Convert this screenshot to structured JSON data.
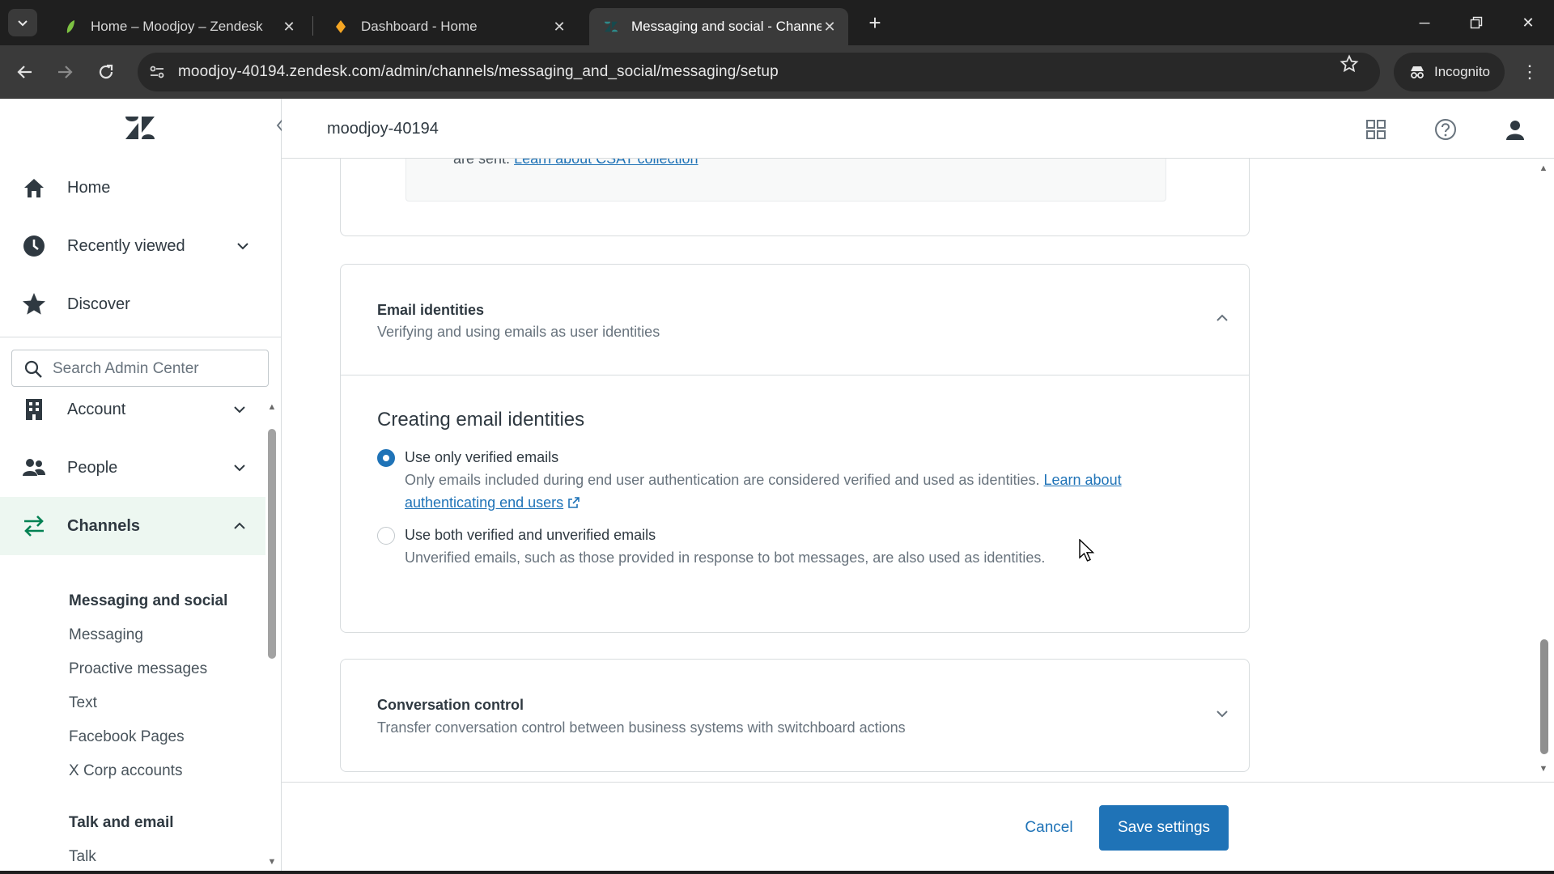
{
  "browser": {
    "tabs": [
      {
        "title": "Home – Moodjoy – Zendesk",
        "active": false,
        "favicon": "zendesk-leaf-icon"
      },
      {
        "title": "Dashboard - Home",
        "active": false,
        "favicon": "dashboard-icon"
      },
      {
        "title": "Messaging and social - Channe",
        "active": true,
        "favicon": "zendesk-icon"
      }
    ],
    "url": "moodjoy-40194.zendesk.com/admin/channels/messaging_and_social/messaging/setup",
    "incognito_label": "Incognito"
  },
  "header": {
    "account_name": "moodjoy-40194"
  },
  "sidebar": {
    "top_items": [
      {
        "label": "Home",
        "icon": "home-icon"
      },
      {
        "label": "Recently viewed",
        "icon": "clock-icon"
      },
      {
        "label": "Discover",
        "icon": "star-icon"
      }
    ],
    "search_placeholder": "Search Admin Center",
    "sections": [
      {
        "label": "Account",
        "icon": "building-icon",
        "expanded": false
      },
      {
        "label": "People",
        "icon": "people-icon",
        "expanded": false
      },
      {
        "label": "Channels",
        "icon": "arrows-icon",
        "expanded": true
      }
    ],
    "channels_groups": [
      {
        "heading": "Messaging and social",
        "items": [
          "Messaging",
          "Proactive messages",
          "Text",
          "Facebook Pages",
          "X Corp accounts"
        ]
      },
      {
        "heading": "Talk and email",
        "items": [
          "Talk"
        ]
      }
    ]
  },
  "main": {
    "prev_card_cut_text": "are sent.",
    "prev_card_cut_link": "Learn about CSAT collection",
    "email_identities": {
      "title": "Email identities",
      "subtitle": "Verifying and using emails as user identities",
      "section_heading": "Creating email identities",
      "option1_label": "Use only verified emails",
      "option1_hint": "Only emails included during end user authentication are considered verified and used as identities.",
      "option1_link": "Learn about authenticating end users",
      "option2_label": "Use both verified and unverified emails",
      "option2_hint": "Unverified emails, such as those provided in response to bot messages, are also used as identities.",
      "selected_option": 1
    },
    "conversation_control": {
      "title": "Conversation control",
      "subtitle": "Transfer conversation control between business systems with switchboard actions"
    }
  },
  "footer": {
    "cancel_label": "Cancel",
    "save_label": "Save settings"
  },
  "colors": {
    "brand_blue": "#1f73b7",
    "nav_selected_bg": "#edf7f1",
    "text_primary": "#2f3941",
    "text_secondary": "#68737d"
  }
}
